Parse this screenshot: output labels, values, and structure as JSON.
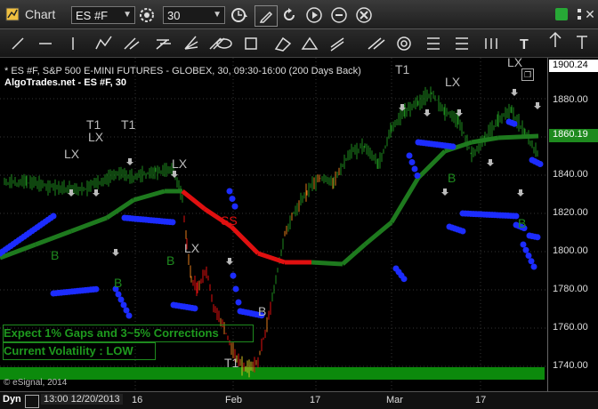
{
  "window": {
    "title": "Chart",
    "symbol": "ES #F",
    "interval": "30"
  },
  "chart": {
    "info_line": "* ES #F, S&P 500 E-MINI FUTURES - GLOBEX, 30, 09:30-16:00 (200 Days Back)",
    "title_line": "AlgoTrades.net - ES #F, 30",
    "note1": "Expect 1% Gaps and 3~5% Corrections",
    "note2": "Current Volatility : LOW",
    "copyright": "© eSignal, 2014",
    "current_price": "1860.19",
    "top_price": "1900.24",
    "signals": [
      "T1",
      "LX",
      "T1",
      "LX",
      "LX",
      "SS",
      "LX",
      "B",
      "B",
      "B",
      "B",
      "T1",
      "LX",
      "LX",
      "T1",
      "B",
      "B"
    ]
  },
  "yaxis": {
    "ticks": [
      "1880.00",
      "1860.00",
      "1840.00",
      "1820.00",
      "1800.00",
      "1780.00",
      "1760.00",
      "1740.00"
    ]
  },
  "xaxis": {
    "dyn_label": "Dyn",
    "date_label": "13:00 12/20/2013",
    "ticks": [
      "16",
      "Feb",
      "17",
      "Mar",
      "17"
    ]
  },
  "colors": {
    "price_up": "#1e8a1e",
    "price_down": "#e01010",
    "band_green": "#1e7a1e",
    "band_red": "#e01010",
    "support_blue": "#1c2cff",
    "orange": "#e07a1a",
    "bottom_bar": "#0c8a0c"
  }
}
